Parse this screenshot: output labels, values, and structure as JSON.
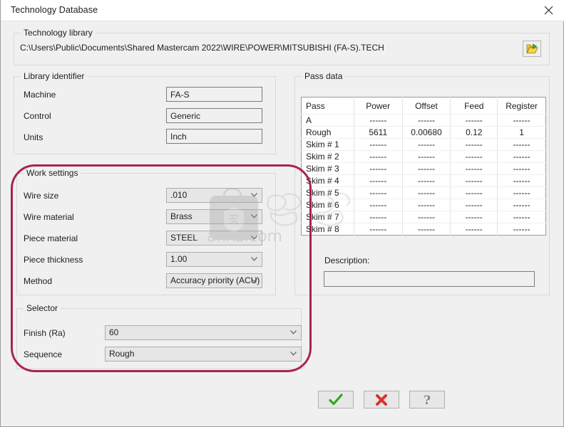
{
  "window": {
    "title": "Technology Database",
    "close_icon": "close-icon"
  },
  "technology_library": {
    "group_label": "Technology library",
    "path": "C:\\Users\\Public\\Documents\\Shared Mastercam 2022\\WIRE\\POWER\\MITSUBISHI (FA-S).TECH",
    "browse_icon": "open-folder-icon"
  },
  "library_identifier": {
    "group_label": "Library identifier",
    "fields": [
      {
        "label": "Machine",
        "value": "FA-S"
      },
      {
        "label": "Control",
        "value": "Generic"
      },
      {
        "label": "Units",
        "value": "Inch"
      }
    ]
  },
  "work_settings": {
    "group_label": "Work settings",
    "fields": [
      {
        "label": "Wire size",
        "value": ".010"
      },
      {
        "label": "Wire material",
        "value": "Brass"
      },
      {
        "label": "Piece material",
        "value": "STEEL"
      },
      {
        "label": "Piece thickness",
        "value": "1.00"
      },
      {
        "label": "Method",
        "value": "Accuracy priority (ACU)"
      }
    ]
  },
  "selector": {
    "group_label": "Selector",
    "fields": [
      {
        "label": "Finish (Ra)",
        "value": "60"
      },
      {
        "label": "Sequence",
        "value": "Rough"
      }
    ]
  },
  "pass_data": {
    "group_label": "Pass data",
    "columns": [
      "Pass",
      "Power",
      "Offset",
      "Feed",
      "Register"
    ],
    "rows": [
      [
        "A",
        "------",
        "------",
        "------",
        "------"
      ],
      [
        "Rough",
        "5611",
        "0.00680",
        "0.12",
        "1"
      ],
      [
        "Skim # 1",
        "------",
        "------",
        "------",
        "------"
      ],
      [
        "Skim # 2",
        "------",
        "------",
        "------",
        "------"
      ],
      [
        "Skim # 3",
        "------",
        "------",
        "------",
        "------"
      ],
      [
        "Skim # 4",
        "------",
        "------",
        "------",
        "------"
      ],
      [
        "Skim # 5",
        "------",
        "------",
        "------",
        "------"
      ],
      [
        "Skim # 6",
        "------",
        "------",
        "------",
        "------"
      ],
      [
        "Skim # 7",
        "------",
        "------",
        "------",
        "------"
      ],
      [
        "Skim # 8",
        "------",
        "------",
        "------",
        "------"
      ]
    ]
  },
  "description": {
    "label": "Description:",
    "value": ""
  },
  "buttons": {
    "ok": "check-icon",
    "cancel": "red-x-icon",
    "help": "question-mark-icon"
  },
  "annotation": {
    "shape": "rounded-rect-highlight",
    "color": "#a8244f"
  },
  "watermark": {
    "text": "anxz.com",
    "cjk_text": "安",
    "icon": "bag-lock-icon"
  }
}
